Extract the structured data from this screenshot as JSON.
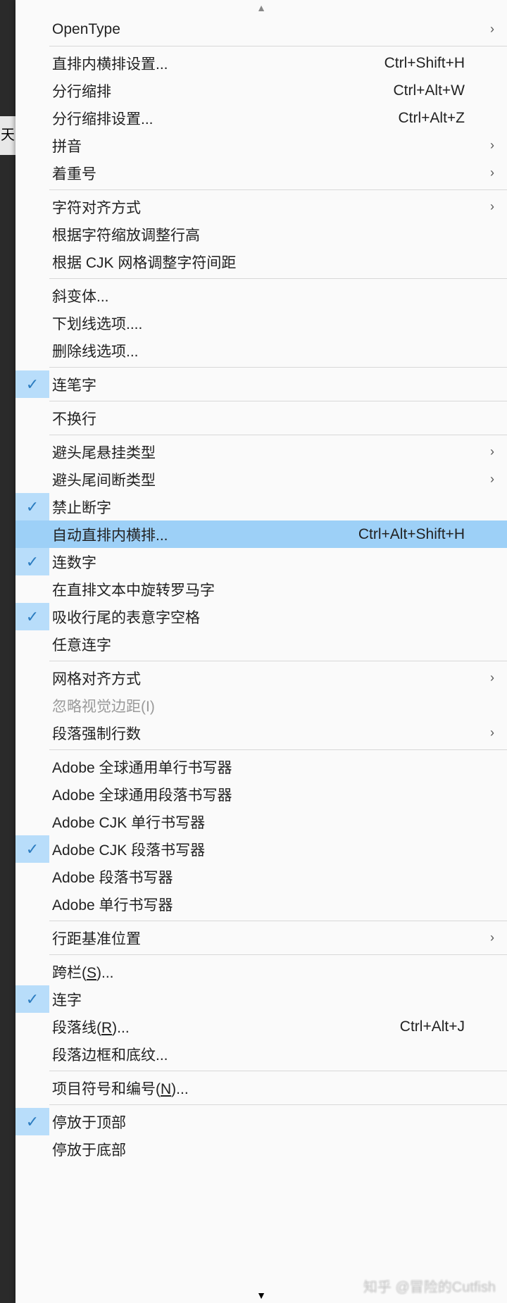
{
  "watermark": "知乎 @冒险的Cutfish",
  "menu": {
    "items": [
      {
        "type": "item",
        "label": "OpenType",
        "submenu": true
      },
      {
        "type": "sep"
      },
      {
        "type": "item",
        "label": "直排内横排设置...",
        "shortcut": "Ctrl+Shift+H"
      },
      {
        "type": "item",
        "label": "分行缩排",
        "shortcut": "Ctrl+Alt+W"
      },
      {
        "type": "item",
        "label": "分行缩排设置...",
        "shortcut": "Ctrl+Alt+Z"
      },
      {
        "type": "item",
        "label": "拼音",
        "submenu": true
      },
      {
        "type": "item",
        "label": "着重号",
        "submenu": true
      },
      {
        "type": "sep"
      },
      {
        "type": "item",
        "label": "字符对齐方式",
        "submenu": true
      },
      {
        "type": "item",
        "label": "根据字符缩放调整行高"
      },
      {
        "type": "item",
        "label": "根据 CJK 网格调整字符间距"
      },
      {
        "type": "sep"
      },
      {
        "type": "item",
        "label": "斜变体..."
      },
      {
        "type": "item",
        "label": "下划线选项...."
      },
      {
        "type": "item",
        "label": "删除线选项..."
      },
      {
        "type": "sep"
      },
      {
        "type": "item",
        "label": "连笔字",
        "checked": true
      },
      {
        "type": "sep"
      },
      {
        "type": "item",
        "label": "不换行"
      },
      {
        "type": "sep"
      },
      {
        "type": "item",
        "label": "避头尾悬挂类型",
        "submenu": true
      },
      {
        "type": "item",
        "label": "避头尾间断类型",
        "submenu": true
      },
      {
        "type": "item",
        "label": "禁止断字",
        "checked": true
      },
      {
        "type": "item",
        "label": "自动直排内横排...",
        "shortcut": "Ctrl+Alt+Shift+H",
        "highlight": true
      },
      {
        "type": "item",
        "label": "连数字",
        "checked": true
      },
      {
        "type": "item",
        "label": "在直排文本中旋转罗马字"
      },
      {
        "type": "item",
        "label": "吸收行尾的表意字空格",
        "checked": true
      },
      {
        "type": "item",
        "label": "任意连字"
      },
      {
        "type": "sep"
      },
      {
        "type": "item",
        "label": "网格对齐方式",
        "submenu": true
      },
      {
        "type": "item",
        "label": "忽略视觉边距(I)",
        "disabled": true
      },
      {
        "type": "item",
        "label": "段落强制行数",
        "submenu": true
      },
      {
        "type": "sep"
      },
      {
        "type": "item",
        "label": "Adobe 全球通用单行书写器"
      },
      {
        "type": "item",
        "label": "Adobe 全球通用段落书写器"
      },
      {
        "type": "item",
        "label": "Adobe CJK 单行书写器"
      },
      {
        "type": "item",
        "label": "Adobe CJK 段落书写器",
        "checked": true
      },
      {
        "type": "item",
        "label": "Adobe 段落书写器"
      },
      {
        "type": "item",
        "label": "Adobe 单行书写器"
      },
      {
        "type": "sep"
      },
      {
        "type": "item",
        "label": "行距基准位置",
        "submenu": true
      },
      {
        "type": "sep"
      },
      {
        "type": "item",
        "label": "跨栏(S)...",
        "underline": "S"
      },
      {
        "type": "item",
        "label": "连字",
        "checked": true
      },
      {
        "type": "item",
        "label": "段落线(R)...",
        "underline": "R",
        "shortcut": "Ctrl+Alt+J"
      },
      {
        "type": "item",
        "label": "段落边框和底纹..."
      },
      {
        "type": "sep"
      },
      {
        "type": "item",
        "label": "项目符号和编号(N)...",
        "underline": "N"
      },
      {
        "type": "sep"
      },
      {
        "type": "item",
        "label": "停放于顶部",
        "checked": true
      },
      {
        "type": "item",
        "label": "停放于底部"
      }
    ]
  }
}
